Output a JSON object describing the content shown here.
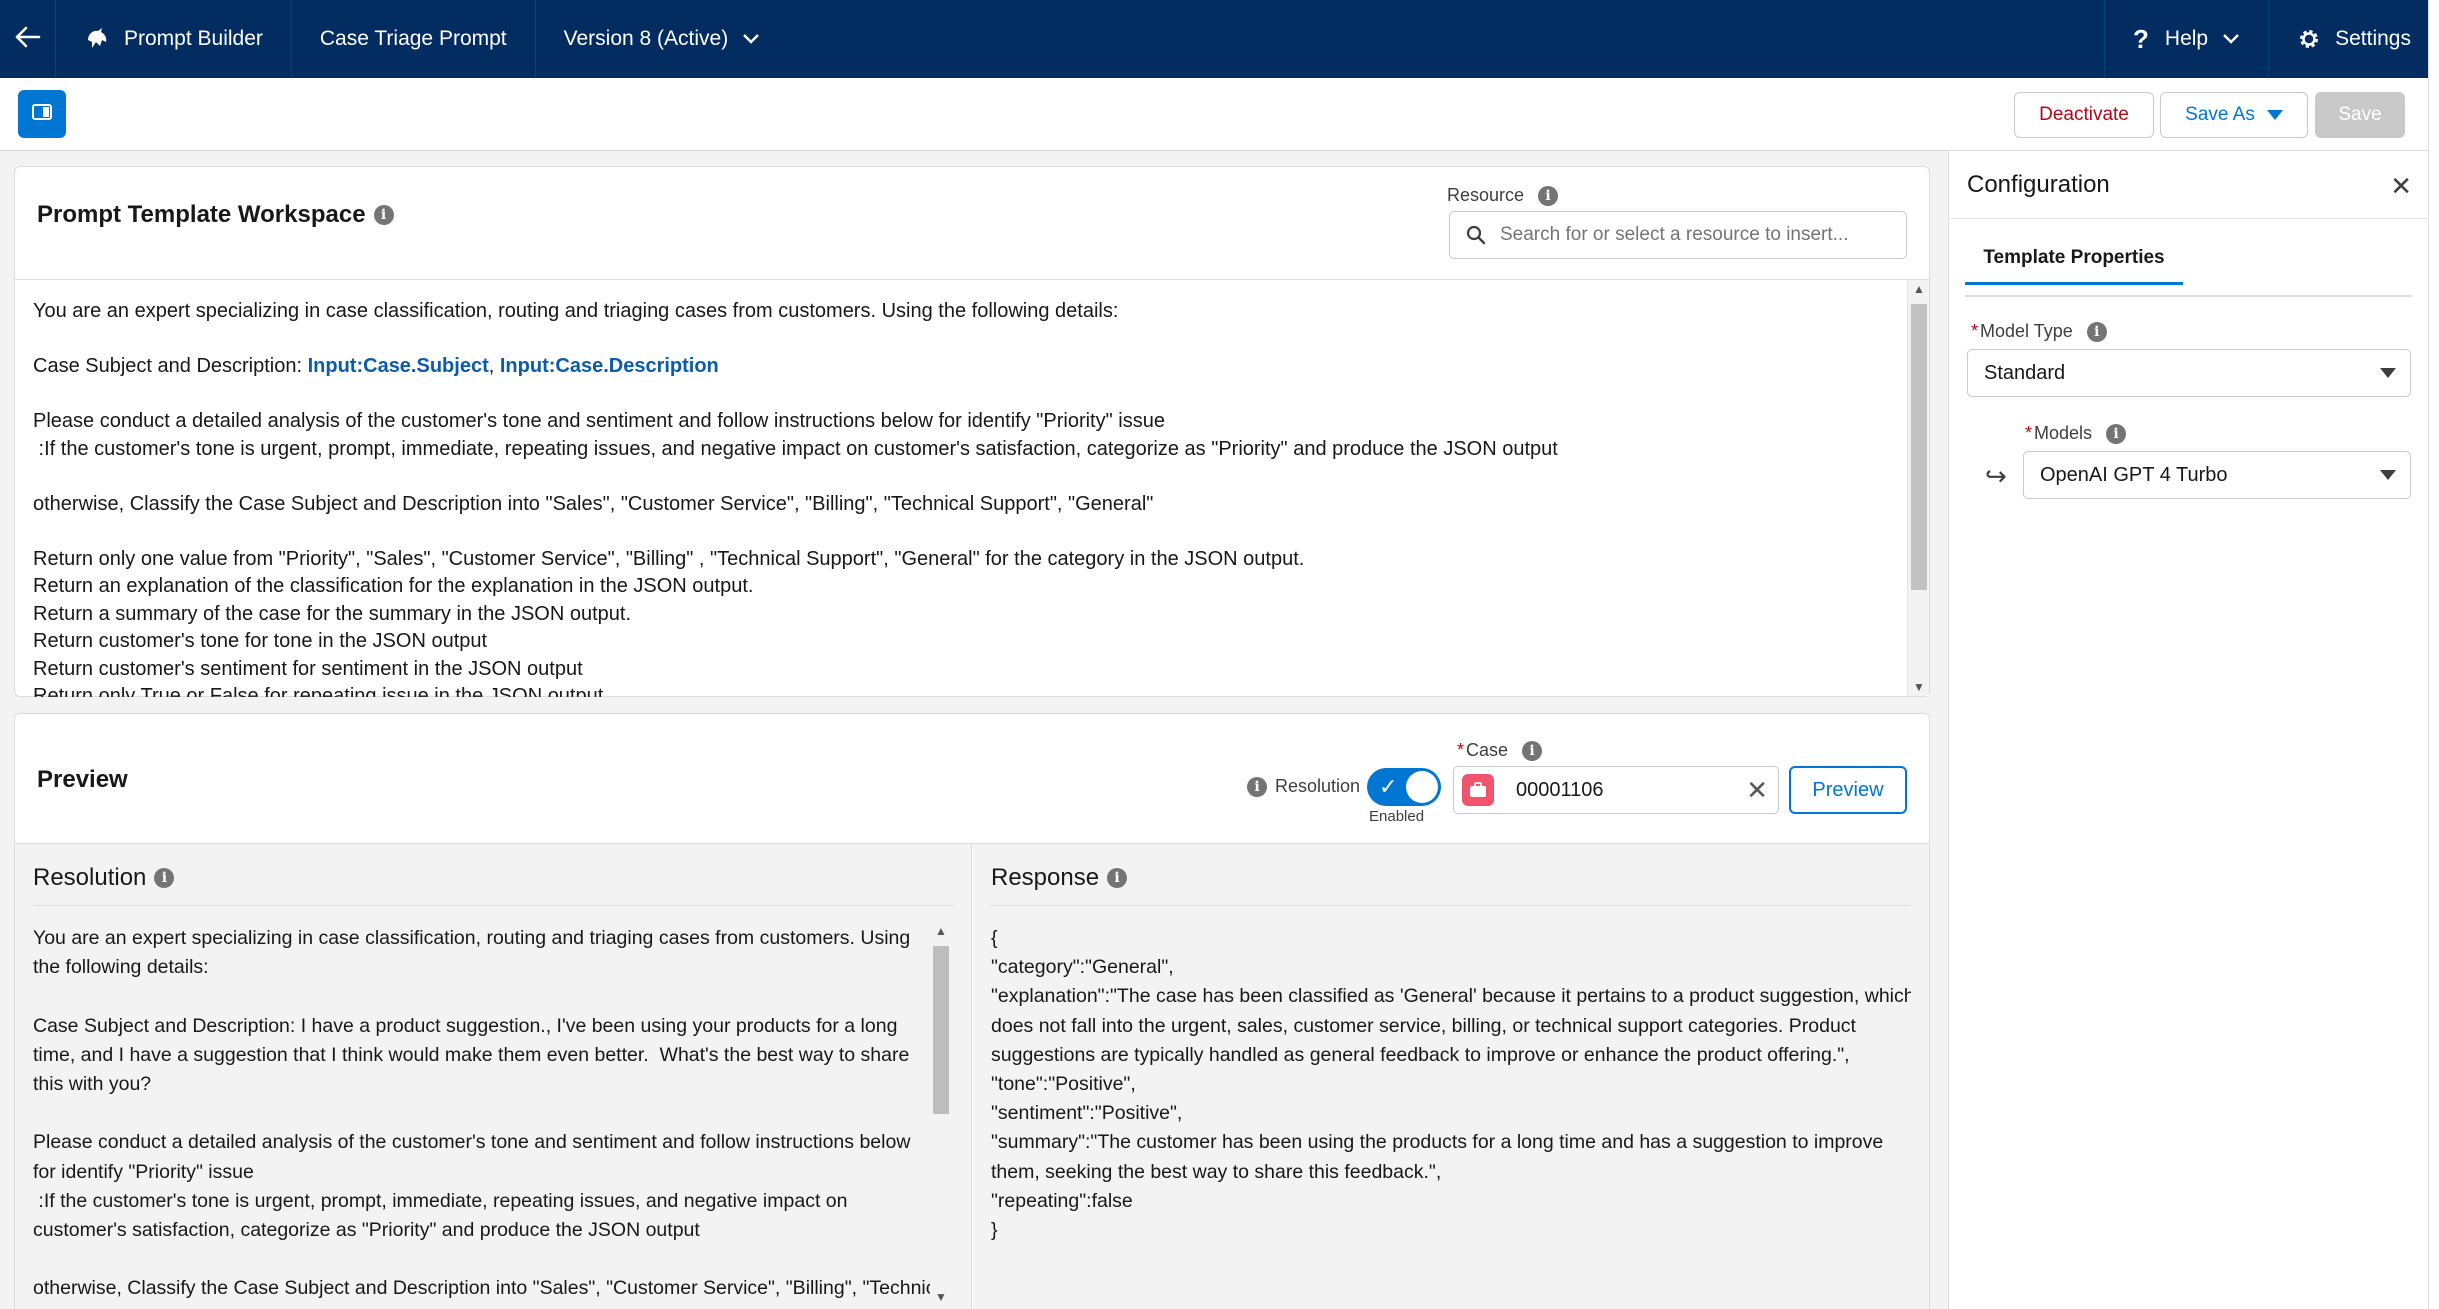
{
  "topbar": {
    "back_icon": "arrow-left-icon",
    "app_icon": "einstein-icon",
    "app_name": "Prompt Builder",
    "template_name": "Case Triage Prompt",
    "version": "Version 8 (Active)",
    "help": "Help",
    "settings": "Settings",
    "background": "#032d60"
  },
  "toolbar": {
    "deactivate": "Deactivate",
    "save_as": "Save As",
    "save": "Save"
  },
  "workspace": {
    "title": "Prompt Template Workspace",
    "resource_label": "Resource",
    "resource_placeholder": "Search for or select a resource to insert...",
    "lines": {
      "l1": "You are an expert specializing in case classification, routing and triaging cases from customers. Using the following details:",
      "l2_prefix": "Case Subject and Description: ",
      "l2_merge1": "Input:Case.Subject",
      "l2_sep": ", ",
      "l2_merge2": "Input:Case.Description",
      "l3": "Please conduct a detailed analysis of the customer's tone and sentiment and follow instructions below for identify \"Priority\" issue",
      "l4": " :If the customer's tone is urgent, prompt, immediate, repeating issues, and negative impact on customer's satisfaction, categorize as \"Priority\" and produce the JSON output",
      "l5": "otherwise, Classify the Case Subject and Description into \"Sales\", \"Customer Service\", \"Billing\", \"Technical Support\", \"General\"",
      "l6": "Return only one value from \"Priority\", \"Sales\", \"Customer Service\", \"Billing\" , \"Technical Support\", \"General\" for the category in the JSON output.",
      "l7": "Return an explanation of the classification for the explanation in the JSON output.",
      "l8": "Return a summary of the case for the summary in the JSON output.",
      "l9": "Return customer's tone for tone in the JSON output",
      "l10": "Return customer's sentiment for sentiment in the JSON output",
      "l11": "Return only True or False for repeating issue in the JSON output"
    }
  },
  "preview": {
    "title": "Preview",
    "resolution_toggle_label": "Resolution",
    "toggle_caption": "Enabled",
    "case_label": "Case",
    "case_value": "00001106",
    "preview_button": "Preview",
    "resolution": {
      "title": "Resolution",
      "lines": {
        "l1": "You are an expert specializing in case classification, routing and triaging cases from customers. Using",
        "l2": "the following details:",
        "l3": "Case Subject and Description: I have a product suggestion., I've been using your products for a long",
        "l4": "time, and I have a suggestion that I think would make them even better.  What's the best way to share",
        "l5": "this with you?",
        "l6": "Please conduct a detailed analysis of the customer's tone and sentiment and follow instructions below",
        "l7": "for identify \"Priority\" issue",
        "l8": " :If the customer's tone is urgent, prompt, immediate, repeating issues, and negative impact on",
        "l9": "customer's satisfaction, categorize as \"Priority\" and produce the JSON output",
        "l10": "otherwise, Classify the Case Subject and Description into \"Sales\", \"Customer Service\", \"Billing\", \"Technical"
      }
    },
    "response": {
      "title": "Response",
      "lines": {
        "l1": "{",
        "l2": "\"category\":\"General\",",
        "l3": "\"explanation\":\"The case has been classified as 'General' because it pertains to a product suggestion, which",
        "l4": "does not fall into the urgent, sales, customer service, billing, or technical support categories. Product",
        "l5": "suggestions are typically handled as general feedback to improve or enhance the product offering.\",",
        "l6": "\"tone\":\"Positive\",",
        "l7": "\"sentiment\":\"Positive\",",
        "l8": "\"summary\":\"The customer has been using the products for a long time and has a suggestion to improve",
        "l9": "them, seeking the best way to share this feedback.\",",
        "l10": "\"repeating\":false",
        "l11": "}"
      }
    }
  },
  "config": {
    "title": "Configuration",
    "tab": "Template Properties",
    "model_type_label": "Model Type",
    "model_type_value": "Standard",
    "models_label": "Models",
    "models_value": "OpenAI GPT 4 Turbo"
  },
  "colors": {
    "brand_blue": "#0176d3",
    "nav_blue": "#032d60",
    "deactivate_red": "#ba0517",
    "merge_field": "#0b5cab"
  }
}
